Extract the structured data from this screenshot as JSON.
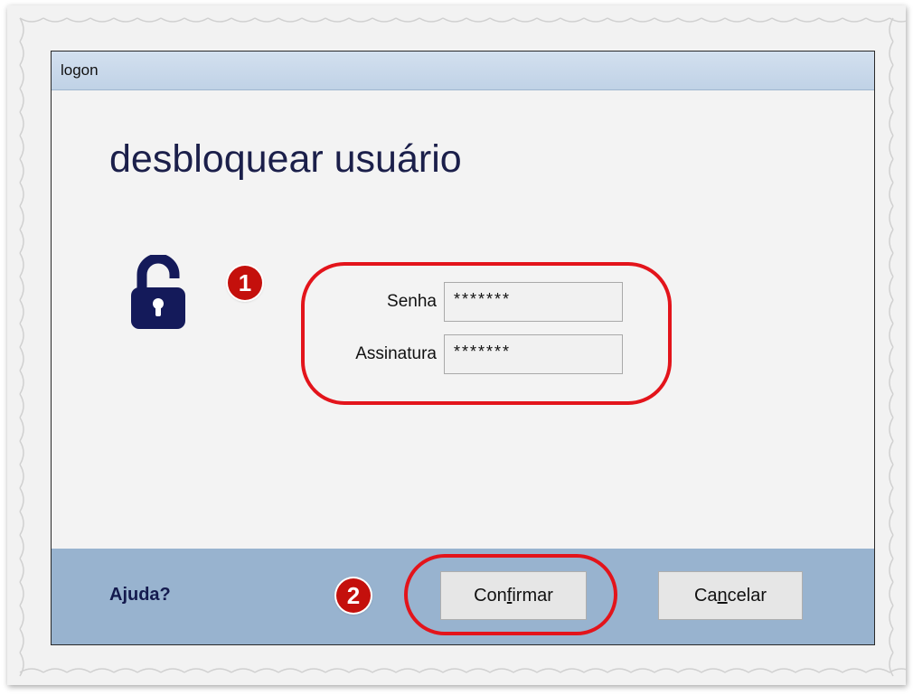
{
  "window": {
    "title": "logon"
  },
  "main": {
    "heading": "desbloquear usuário",
    "icon": "lock-open-icon",
    "annotations": [
      "1",
      "2"
    ],
    "fields": [
      {
        "label": "Senha",
        "value": "*******"
      },
      {
        "label": "Assinatura",
        "value": "*******"
      }
    ]
  },
  "footer": {
    "help_label": "Ajuda?",
    "confirm_pre": "Con",
    "confirm_key": "f",
    "confirm_post": "irmar",
    "cancel_pre": "Ca",
    "cancel_key": "n",
    "cancel_post": "celar"
  },
  "colors": {
    "titlebar": "#c9d9ea",
    "footer": "#98b3cf",
    "heading": "#1b1f4a",
    "icon": "#141a5a",
    "highlight": "#e3141b",
    "badge": "#c4100c"
  }
}
